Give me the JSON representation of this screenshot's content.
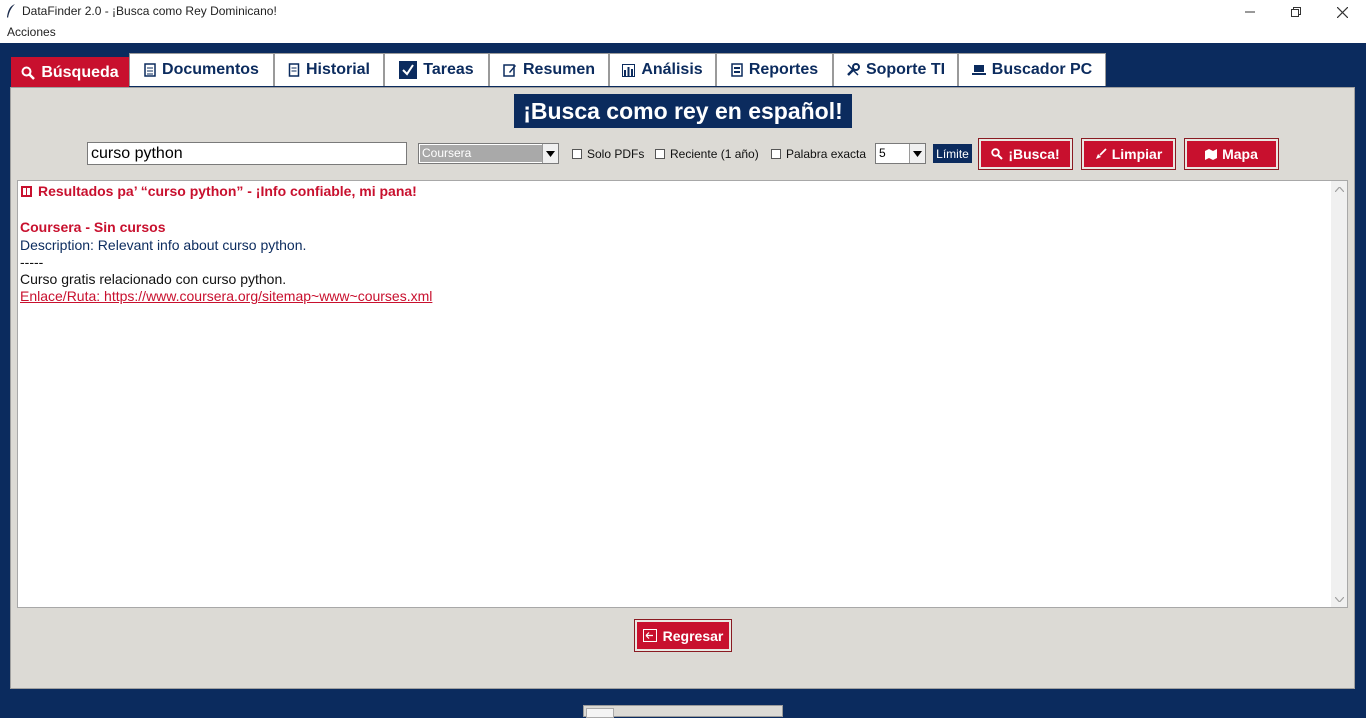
{
  "window": {
    "title": "DataFinder 2.0 - ¡Busca como Rey Dominicano!",
    "menu": "Acciones"
  },
  "tabs": [
    {
      "label": "Búsqueda",
      "icon": "magnifier-icon",
      "active": true
    },
    {
      "label": "Documentos",
      "icon": "document-icon"
    },
    {
      "label": "Historial",
      "icon": "scroll-icon"
    },
    {
      "label": "Tareas",
      "icon": "checkbox-icon"
    },
    {
      "label": "Resumen",
      "icon": "memo-icon"
    },
    {
      "label": "Análisis",
      "icon": "bar-chart-icon"
    },
    {
      "label": "Reportes",
      "icon": "report-icon"
    },
    {
      "label": "Soporte TI",
      "icon": "tools-icon"
    },
    {
      "label": "Buscador PC",
      "icon": "laptop-icon"
    }
  ],
  "banner": "¡Busca como rey en español!",
  "search": {
    "query": "curso python",
    "source": "Coursera",
    "checkboxes": [
      {
        "label": "Solo PDFs",
        "checked": false
      },
      {
        "label": "Reciente (1 año)",
        "checked": false
      },
      {
        "label": "Palabra exacta",
        "checked": false
      }
    ],
    "limit_value": "5",
    "limit_label": "Límite",
    "buttons": {
      "search": "¡Busca!",
      "clear": "Limpiar",
      "map": "Mapa"
    }
  },
  "results": {
    "header": "Resultados pa’ “curso python” - ¡Info confiable, mi pana!",
    "item_title": "Coursera - Sin cursos",
    "description": "Description: Relevant info about curso python.",
    "separator": "-----",
    "body": "Curso gratis relacionado con curso python.",
    "link": "Enlace/Ruta: https://www.coursera.org/sitemap~www~courses.xml"
  },
  "back_button": "Regresar",
  "colors": {
    "brand_red": "#c8102e",
    "navy": "#0b2b5e",
    "panel": "#dcdad5"
  }
}
